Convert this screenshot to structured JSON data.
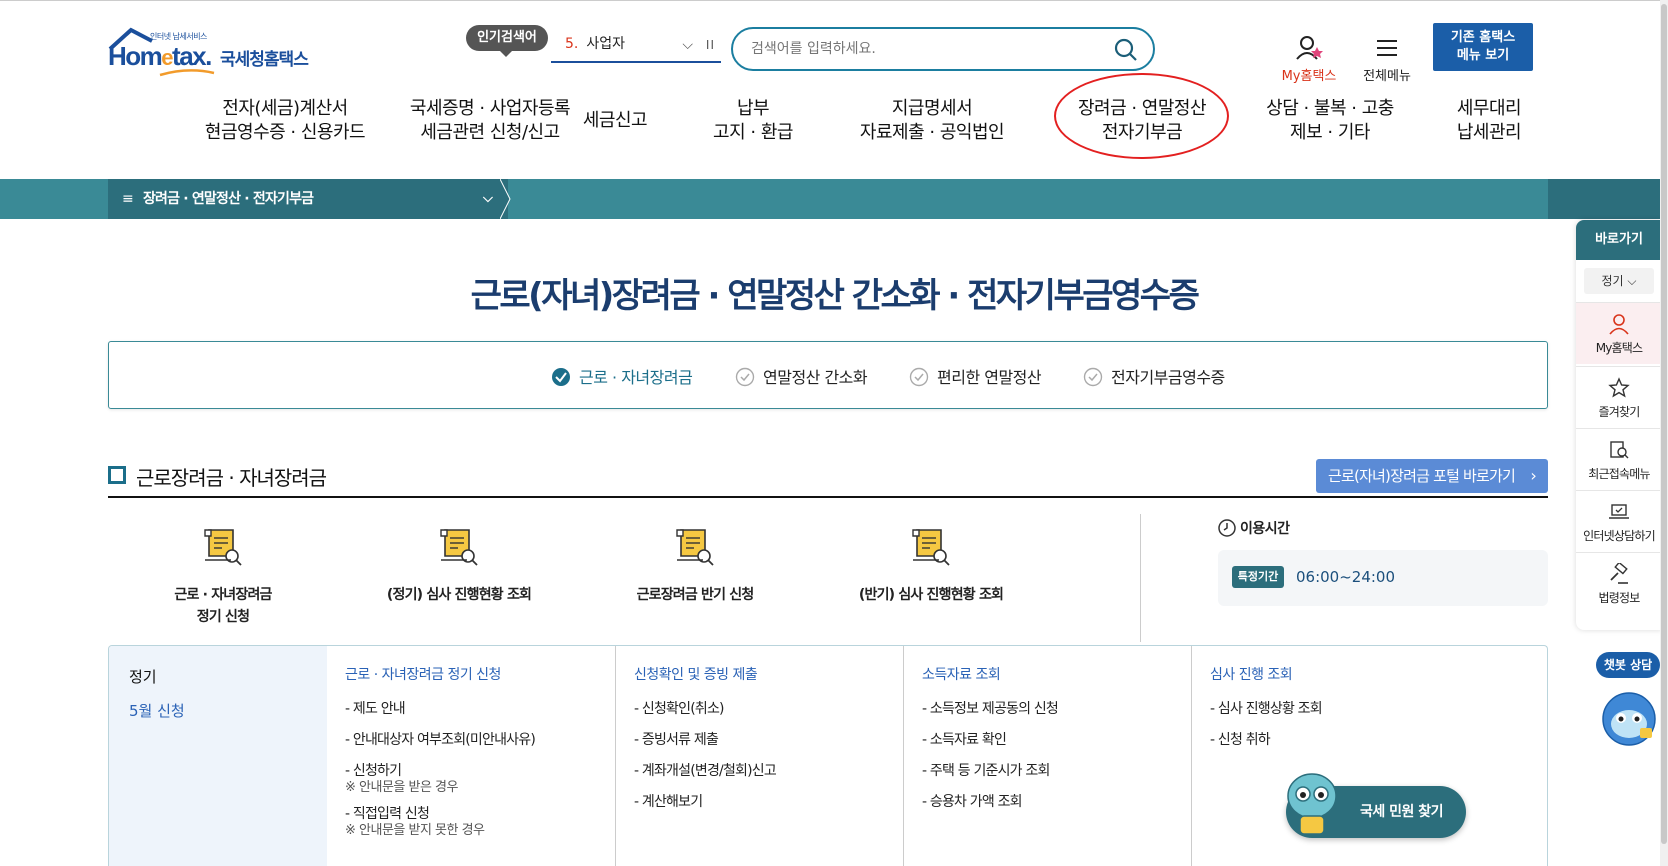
{
  "header": {
    "logo_small": "인터넷 납세서비스",
    "logo_main_pre": "Hom",
    "logo_main_e": "e",
    "logo_main_post": "tax.",
    "logo_kr": "국세청홈택스",
    "popular_label": "인기검색어",
    "popular_num": "5.",
    "popular_word": "사업자",
    "search_placeholder": "검색어를 입력하세요.",
    "my_hometax": "My홈택스",
    "all_menu": "전체메뉴",
    "old_home_line1": "기존 홈택스",
    "old_home_line2": "메뉴 보기"
  },
  "gnb": [
    {
      "l1": "전자(세금)계산서",
      "l2": "현금영수증 · 신용카드"
    },
    {
      "l1": "국세증명 · 사업자등록",
      "l2": "세금관련 신청/신고"
    },
    {
      "l1": "세금신고",
      "l2": ""
    },
    {
      "l1": "납부",
      "l2": "고지 · 환급"
    },
    {
      "l1": "지급명세서",
      "l2": "자료제출 · 공익법인"
    },
    {
      "l1": "장려금 · 연말정산",
      "l2": "전자기부금"
    },
    {
      "l1": "상담 · 불복 · 고충",
      "l2": "제보 · 기타"
    },
    {
      "l1": "세무대리",
      "l2": "납세관리"
    }
  ],
  "subnav": {
    "current": "장려금 · 연말정산 · 전자기부금"
  },
  "page_title": "근로(자녀)장려금 · 연말정산 간소화 · 전자기부금영수증",
  "tabs": [
    {
      "label": "근로 · 자녀장려금"
    },
    {
      "label": "연말정산 간소화"
    },
    {
      "label": "편리한 연말정산"
    },
    {
      "label": "전자기부금영수증"
    }
  ],
  "section": {
    "title": "근로장려금 · 자녀장려금",
    "portal_button": "근로(자녀)장려금 포털 바로가기"
  },
  "services": [
    {
      "l1": "근로 · 자녀장려금",
      "l2": "정기 신청"
    },
    {
      "l1": "(정기) 심사 진행현황 조회",
      "l2": ""
    },
    {
      "l1": "근로장려금 반기 신청",
      "l2": ""
    },
    {
      "l1": "(반기) 심사 진행현황 조회",
      "l2": ""
    }
  ],
  "usage": {
    "title": "이용시간",
    "badge": "특정기간",
    "time": "06:00~24:00"
  },
  "grid": {
    "left_title": "정기",
    "left_sub": "5월 신청",
    "columns": [
      {
        "head": "근로 · 자녀장려금 정기 신청",
        "items": [
          "- 제도 안내",
          "- 안내대상자 여부조회(미안내사유)",
          "- 신청하기",
          "- 직접입력 신청"
        ],
        "notes": [
          "",
          "",
          "※ 안내문을 받은 경우",
          "※ 안내문을 받지 못한 경우"
        ]
      },
      {
        "head": "신청확인 및 증빙 제출",
        "items": [
          "- 신청확인(취소)",
          "- 증빙서류 제출",
          "- 계좌개설(변경/철회)신고",
          "- 계산해보기"
        ],
        "notes": [
          "",
          "",
          "",
          ""
        ]
      },
      {
        "head": "소득자료 조회",
        "items": [
          "- 소득정보 제공동의 신청",
          "- 소득자료 확인",
          "- 주택 등 기준시가 조회",
          "- 승용차 가액 조회"
        ],
        "notes": [
          "",
          "",
          "",
          ""
        ]
      },
      {
        "head": "심사 진행 조회",
        "items": [
          "- 심사 진행상황 조회",
          "- 신청 취하"
        ],
        "notes": [
          "",
          ""
        ]
      }
    ]
  },
  "quick": {
    "title": "바로가기",
    "select": "정기",
    "items": [
      "My홈택스",
      "즐겨찾기",
      "최근접속메뉴",
      "인터넷상담하기",
      "법령정보"
    ]
  },
  "chatbot": {
    "label": "챗봇 상담"
  },
  "float_button": {
    "label": "국세 민원 찾기"
  },
  "colors": {
    "brand": "#1b4f9c",
    "teal": "#2c6e7c",
    "accent_red": "#e32020"
  }
}
